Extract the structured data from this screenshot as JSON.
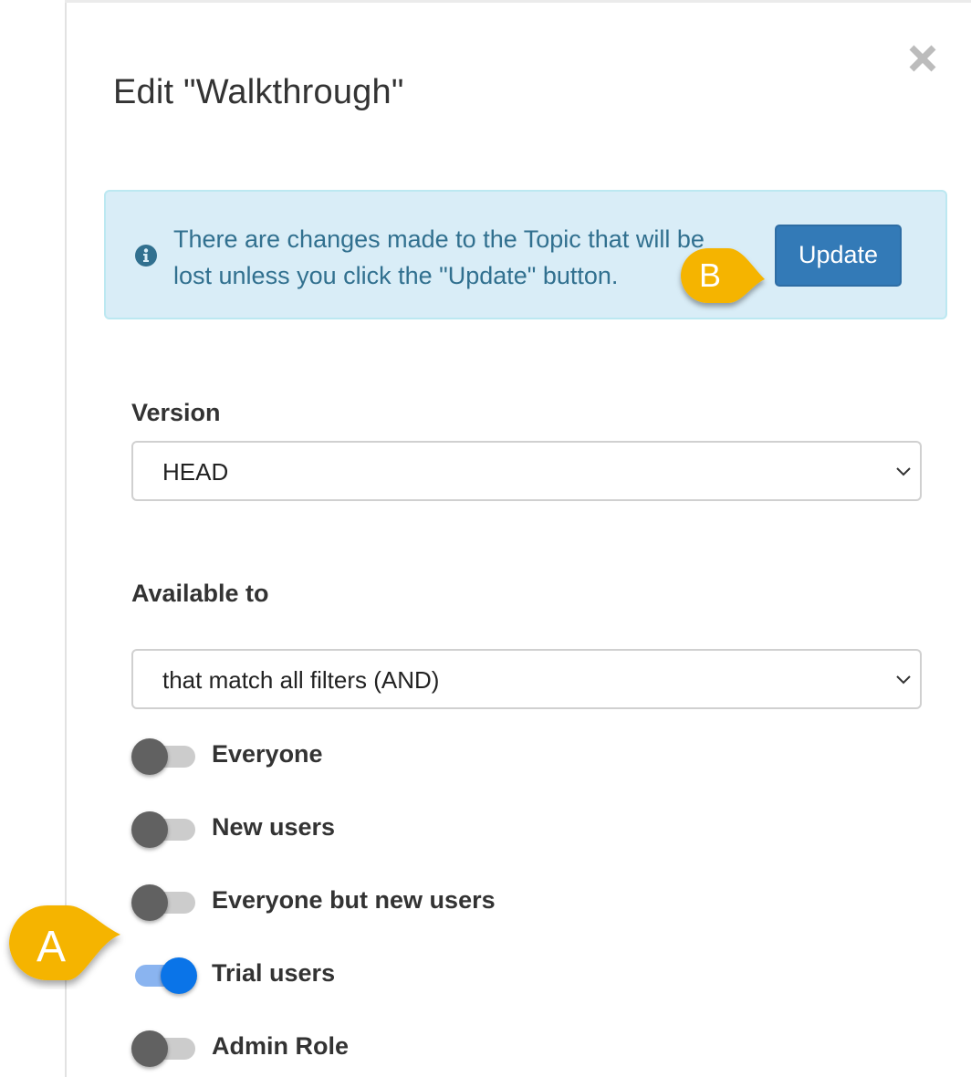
{
  "dialog": {
    "title": "Edit \"Walkthrough\"",
    "close_icon": "close-icon"
  },
  "alert": {
    "icon": "info-circle-icon",
    "line1": "There are changes made to the Topic that will be",
    "line2": "lost unless you click the \"Update\" button.",
    "update_label": "Update"
  },
  "version": {
    "label": "Version",
    "selected": "HEAD"
  },
  "available_to": {
    "label": "Available to",
    "selected": "that match all filters (AND)",
    "toggles": [
      {
        "label": "Everyone",
        "on": false
      },
      {
        "label": "New users",
        "on": false
      },
      {
        "label": "Everyone but new users",
        "on": false
      },
      {
        "label": "Trial users",
        "on": true
      },
      {
        "label": "Admin Role",
        "on": false
      }
    ]
  },
  "callouts": {
    "a": "A",
    "b": "B"
  },
  "colors": {
    "alert_bg": "#d9edf7",
    "alert_text": "#31708f",
    "primary_button": "#337ab7",
    "toggle_on": "#0a74e8",
    "callout": "#f5b400"
  }
}
